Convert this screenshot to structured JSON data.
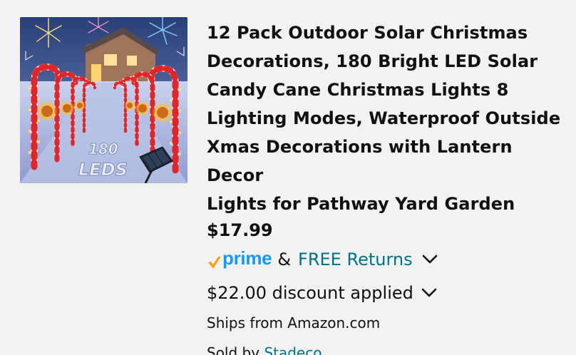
{
  "product": {
    "image_alt": "Solar candy cane Christmas pathway lights",
    "image_overlay_text": [
      "180",
      "LEDS"
    ],
    "title_lines": [
      "12 Pack Outdoor Solar Christmas",
      "Decorations, 180 Bright LED Solar",
      "Candy Cane Christmas Lights 8",
      "Lighting Modes, Waterproof Outside",
      "Xmas Decorations with Lantern Decor",
      "Lights for Pathway Yard Garden"
    ],
    "price": "$17.99",
    "prime_label": "prime",
    "amp": "&",
    "free_returns": "FREE Returns",
    "discount": "$22.00 discount applied",
    "ships_from": "Ships from Amazon.com",
    "sold_by_prefix": "Sold by",
    "seller": "Stadeco"
  },
  "colors": {
    "prime_blue": "#1399ff",
    "prime_check": "#f7a21b",
    "link_teal": "#007185",
    "text": "#0f1111",
    "background": "#f2f2f2"
  },
  "icons": {
    "prime_check": "checkmark-icon",
    "returns_chevron": "chevron-down-icon",
    "discount_chevron": "chevron-down-icon"
  }
}
